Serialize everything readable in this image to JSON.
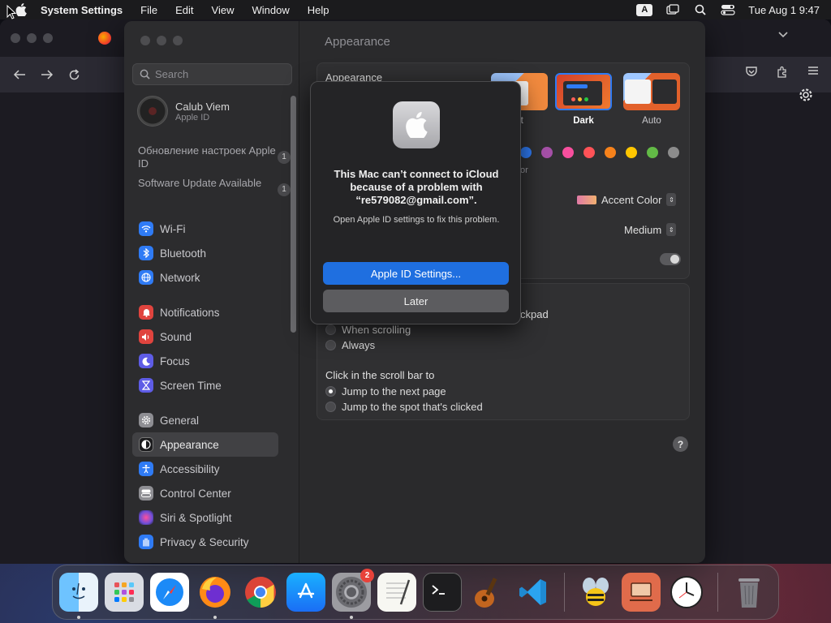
{
  "menubar": {
    "app_name": "System Settings",
    "menus": [
      "File",
      "Edit",
      "View",
      "Window",
      "Help"
    ],
    "input_source": "A",
    "clock": "Tue Aug 1  9:47"
  },
  "sidebar": {
    "search_placeholder": "Search",
    "account_name": "Calub Viem",
    "account_sub": "Apple ID",
    "notices": [
      {
        "label": "Обновление настроек Apple ID",
        "count": "1"
      },
      {
        "label": "Software Update Available",
        "count": "1"
      }
    ],
    "group1": [
      {
        "label": "Wi-Fi",
        "icon": "wifi-icon",
        "color": "#2f7bf5"
      },
      {
        "label": "Bluetooth",
        "icon": "bluetooth-icon",
        "color": "#2f7bf5"
      },
      {
        "label": "Network",
        "icon": "globe-icon",
        "color": "#2f7bf5"
      }
    ],
    "group2": [
      {
        "label": "Notifications",
        "icon": "bell-icon",
        "color": "#e0443e"
      },
      {
        "label": "Sound",
        "icon": "speaker-icon",
        "color": "#e0443e"
      },
      {
        "label": "Focus",
        "icon": "moon-icon",
        "color": "#5e5ce6"
      },
      {
        "label": "Screen Time",
        "icon": "hourglass-icon",
        "color": "#5e5ce6"
      }
    ],
    "group3": [
      {
        "label": "General",
        "icon": "gear-icon",
        "color": "#8e8e93"
      },
      {
        "label": "Appearance",
        "icon": "appearance-icon",
        "color": "#1c1c1e"
      },
      {
        "label": "Accessibility",
        "icon": "accessibility-icon",
        "color": "#2f7bf5"
      },
      {
        "label": "Control Center",
        "icon": "control-center-icon",
        "color": "#8e8e93"
      },
      {
        "label": "Siri & Spotlight",
        "icon": "siri-icon",
        "color": "#b04ec9"
      },
      {
        "label": "Privacy & Security",
        "icon": "hand-icon",
        "color": "#2f7bf5"
      }
    ],
    "active": "Appearance"
  },
  "main": {
    "title": "Appearance",
    "appearance_label": "Appearance",
    "modes": [
      {
        "label": "Light",
        "visible_label": "nt"
      },
      {
        "label": "Dark"
      },
      {
        "label": "Auto"
      }
    ],
    "selected_mode": "Dark",
    "accent_colors": [
      "#2f7bf5",
      "#a550a7",
      "#f74f9e",
      "#ff5257",
      "#f7821b",
      "#ffc600",
      "#62ba46",
      "#8c8c8c"
    ],
    "accent_row_fragment": "or",
    "highlight_color_label": "Accent Color",
    "sidebar_icon_size": "Medium",
    "scroll_fragment": "ckpad",
    "show_scroll_options": [
      "When scrolling",
      "Always"
    ],
    "click_scroll_label": "Click in the scroll bar to",
    "click_scroll_options": [
      "Jump to the next page",
      "Jump to the spot that's clicked"
    ],
    "click_scroll_selected": "Jump to the next page"
  },
  "dialog": {
    "title": "This Mac can’t connect to iCloud because of a problem with “re579082@gmail.com”.",
    "message": "Open Apple ID settings to fix this problem.",
    "primary_button": "Apple ID Settings...",
    "secondary_button": "Later"
  },
  "dock": {
    "apps": [
      {
        "name": "Finder",
        "icon": "finder-icon",
        "running": true
      },
      {
        "name": "Launchpad",
        "icon": "launchpad-icon",
        "running": false
      },
      {
        "name": "Safari",
        "icon": "safari-icon",
        "running": false
      },
      {
        "name": "Firefox",
        "icon": "firefox-icon",
        "running": true
      },
      {
        "name": "Chrome",
        "icon": "chrome-icon",
        "running": false
      },
      {
        "name": "App Store",
        "icon": "appstore-icon",
        "running": false
      },
      {
        "name": "System Settings",
        "icon": "system-settings-icon",
        "running": true,
        "badge": "2"
      },
      {
        "name": "TextEdit",
        "icon": "textedit-icon",
        "running": false
      },
      {
        "name": "Terminal",
        "icon": "terminal-icon",
        "running": false
      },
      {
        "name": "GarageBand",
        "icon": "garageband-icon",
        "running": false
      },
      {
        "name": "Visual Studio Code",
        "icon": "vscode-icon",
        "running": false
      }
    ],
    "extras": [
      {
        "name": "Bee",
        "icon": "bee-icon"
      },
      {
        "name": "Remote Desktop",
        "icon": "remote-desktop-icon"
      },
      {
        "name": "Clock",
        "icon": "clock-icon"
      }
    ],
    "trash": {
      "name": "Trash",
      "icon": "trash-icon"
    }
  }
}
